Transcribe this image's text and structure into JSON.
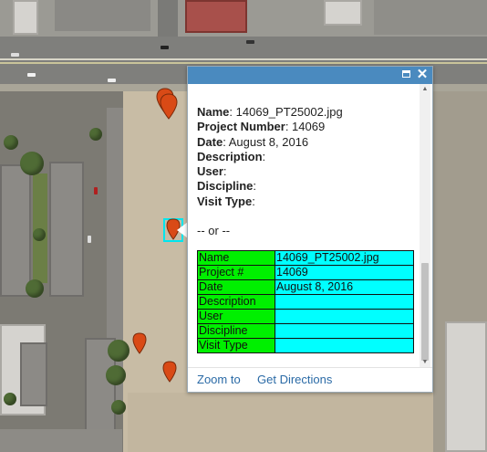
{
  "popup": {
    "fields": [
      {
        "label": "Name",
        "value": " 14069_PT25002.jpg"
      },
      {
        "label": "Project Number",
        "value": " 14069"
      },
      {
        "label": "Date",
        "value": " August 8, 2016"
      },
      {
        "label": "Description",
        "value": ""
      },
      {
        "label": "User",
        "value": ""
      },
      {
        "label": "Discipline",
        "value": ""
      },
      {
        "label": "Visit Type",
        "value": ""
      }
    ],
    "separator": "-- or --",
    "table": [
      {
        "key": "Name",
        "value": "14069_PT25002.jpg"
      },
      {
        "key": "Project #",
        "value": "14069"
      },
      {
        "key": "Date",
        "value": "August 8, 2016"
      },
      {
        "key": "Description",
        "value": ""
      },
      {
        "key": "User",
        "value": ""
      },
      {
        "key": "Discipline",
        "value": ""
      },
      {
        "key": "Visit Type",
        "value": ""
      }
    ],
    "actions": {
      "zoom_to": "Zoom to",
      "get_directions": "Get Directions"
    },
    "header_icons": [
      "maximize-icon",
      "close-icon"
    ]
  },
  "map": {
    "markers": [
      "map-pin-marker",
      "map-pin-marker",
      "map-pin-marker-selected",
      "map-pin-marker",
      "map-pin-marker"
    ],
    "colors": {
      "marker": "#d94a16",
      "selection": "#00e5ee",
      "header": "#4a8abf",
      "table_key": "#00f000",
      "table_value": "#00ffff",
      "link": "#2a6aa6"
    }
  }
}
